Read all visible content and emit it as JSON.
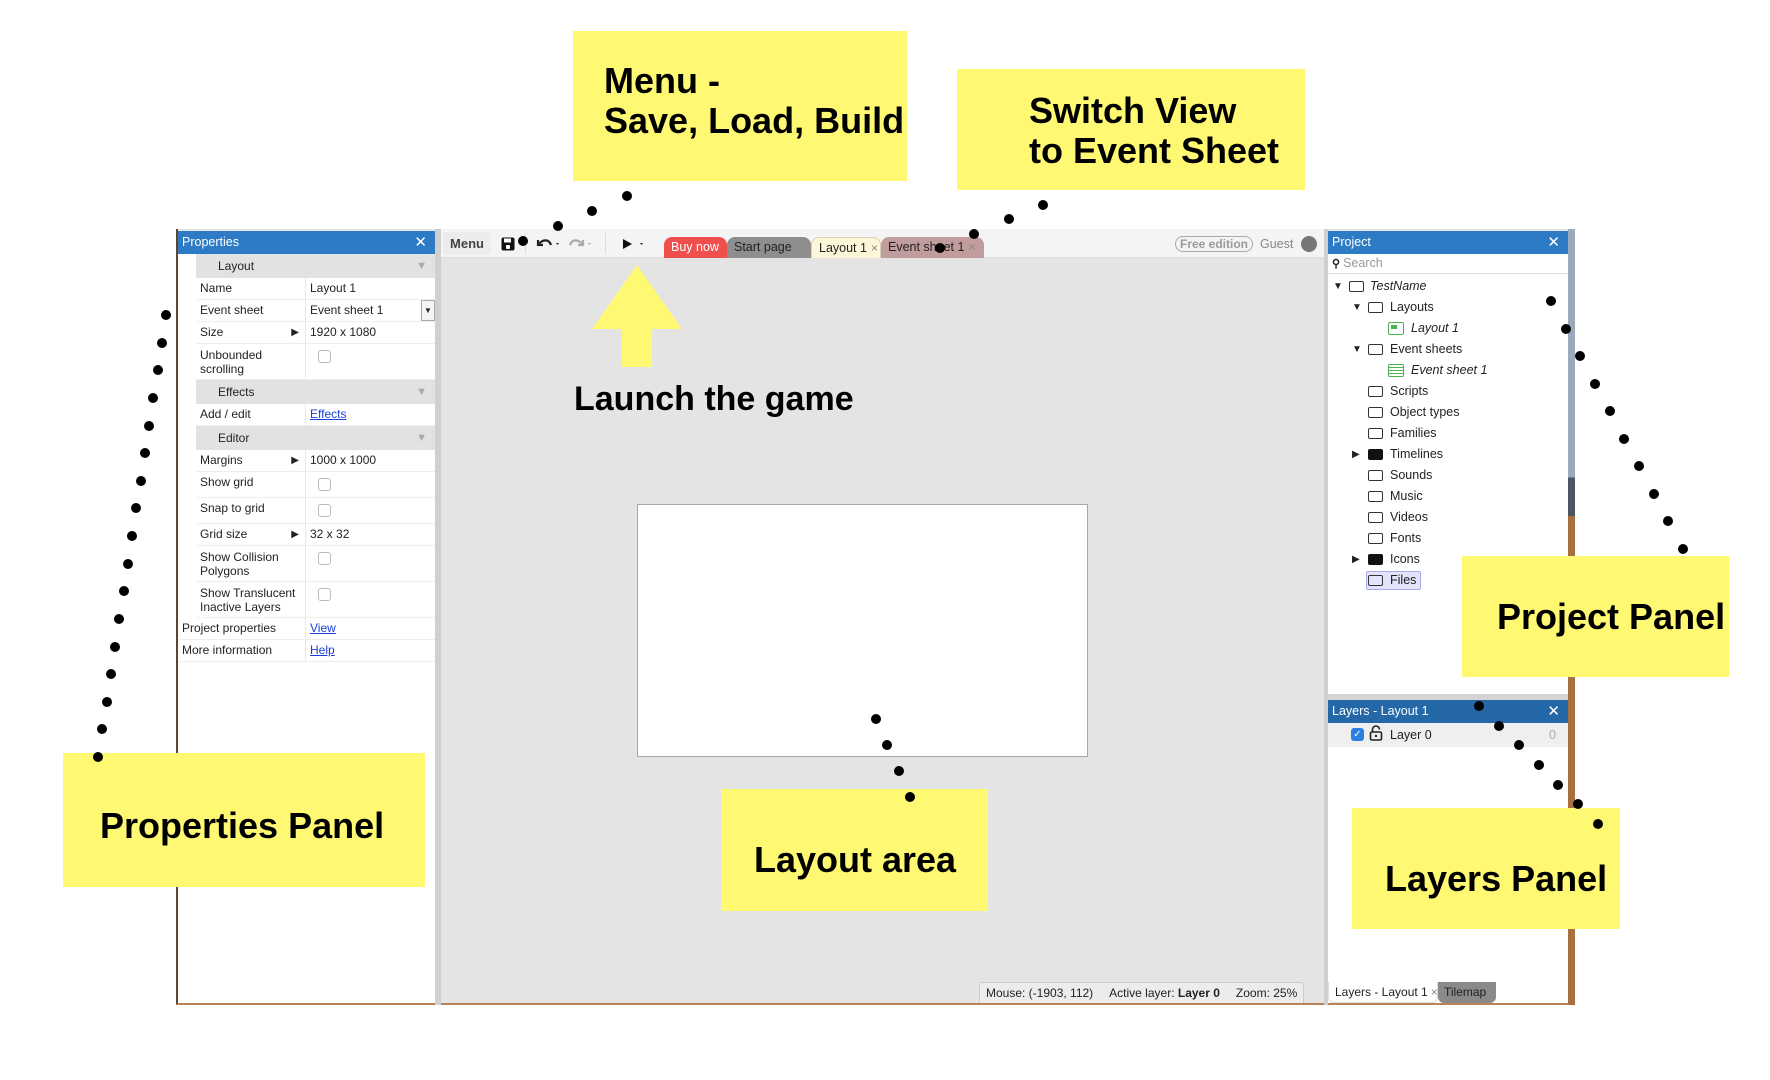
{
  "toolbar": {
    "menu_label": "Menu",
    "save_icon": "save-icon",
    "undo_icon": "undo-icon",
    "redo_icon": "redo-icon",
    "play_icon": "play-icon",
    "tabs": [
      {
        "label": "Buy now",
        "closable": false,
        "color": "#f0504d"
      },
      {
        "label": "Start page",
        "closable": true,
        "color": "#8e8e8e"
      },
      {
        "label": "Layout 1",
        "closable": true,
        "active": true,
        "color": "#fdf6d8"
      },
      {
        "label": "Event sheet 1",
        "closable": true,
        "color": "#c09c9c"
      }
    ],
    "close_glyph": "×",
    "edition_badge": "Free edition",
    "user_label": "Guest"
  },
  "properties": {
    "title": "Properties",
    "close_glyph": "✕",
    "sections": {
      "layout": {
        "label": "Layout",
        "rows": [
          {
            "key": "Name",
            "value": "Layout 1"
          },
          {
            "key": "Event sheet",
            "value": "Event sheet 1"
          },
          {
            "key": "Size",
            "value": "1920 x 1080"
          },
          {
            "key": "Unbounded scrolling",
            "checked": false
          }
        ]
      },
      "effects": {
        "label": "Effects",
        "rows": [
          {
            "key": "Add / edit",
            "link": "Effects"
          }
        ]
      },
      "editor": {
        "label": "Editor",
        "rows": [
          {
            "key": "Margins",
            "value": "1000 x 1000"
          },
          {
            "key": "Show grid",
            "checked": false
          },
          {
            "key": "Snap to grid",
            "checked": false
          },
          {
            "key": "Grid size",
            "value": "32 x 32"
          },
          {
            "key": "Show Collision Polygons",
            "checked": false
          },
          {
            "key": "Show Translucent Inactive Layers",
            "checked": false
          }
        ]
      }
    },
    "footer": [
      {
        "key": "Project properties",
        "link": "View"
      },
      {
        "key": "More information",
        "link": "Help"
      }
    ]
  },
  "statusbar": {
    "mouse": "Mouse: (-1903, 112)",
    "active_layer_label": "Active layer: ",
    "active_layer_value": "Layer 0",
    "zoom": "Zoom: 25%"
  },
  "project": {
    "title": "Project",
    "close_glyph": "✕",
    "search_placeholder": "Search",
    "tree": [
      {
        "label": "TestName",
        "level": 0,
        "expanded": true,
        "italic": true
      },
      {
        "label": "Layouts",
        "level": 1,
        "expanded": true
      },
      {
        "label": "Layout 1",
        "level": 2,
        "italic": true,
        "icon": "layout-icon"
      },
      {
        "label": "Event sheets",
        "level": 1,
        "expanded": true
      },
      {
        "label": "Event sheet 1",
        "level": 2,
        "italic": true,
        "icon": "event-sheet-icon"
      },
      {
        "label": "Scripts",
        "level": 1
      },
      {
        "label": "Object types",
        "level": 1
      },
      {
        "label": "Families",
        "level": 1
      },
      {
        "label": "Timelines",
        "level": 1,
        "collapsed": true
      },
      {
        "label": "Sounds",
        "level": 1
      },
      {
        "label": "Music",
        "level": 1
      },
      {
        "label": "Videos",
        "level": 1
      },
      {
        "label": "Fonts",
        "level": 1
      },
      {
        "label": "Icons",
        "level": 1,
        "collapsed": true
      },
      {
        "label": "Files",
        "level": 1,
        "selected": true
      }
    ]
  },
  "layers": {
    "title": "Layers - Layout 1",
    "close_glyph": "✕",
    "rows": [
      {
        "name": "Layer 0",
        "visible": true,
        "locked": false,
        "index": "0"
      }
    ],
    "bottom_tabs": [
      {
        "label": "Layers - Layout 1",
        "active": true
      },
      {
        "label": "Tilemap",
        "active": false
      }
    ]
  },
  "annotations": {
    "menu": [
      "Menu -",
      "Save, Load, Build"
    ],
    "switch_view": [
      "Switch View",
      "to Event Sheet"
    ],
    "launch": "Launch the game",
    "properties_panel": "Properties Panel",
    "layout_area": "Layout area",
    "project_panel": "Project Panel",
    "layers_panel": "Layers Panel",
    "note_color": "#fff872"
  }
}
